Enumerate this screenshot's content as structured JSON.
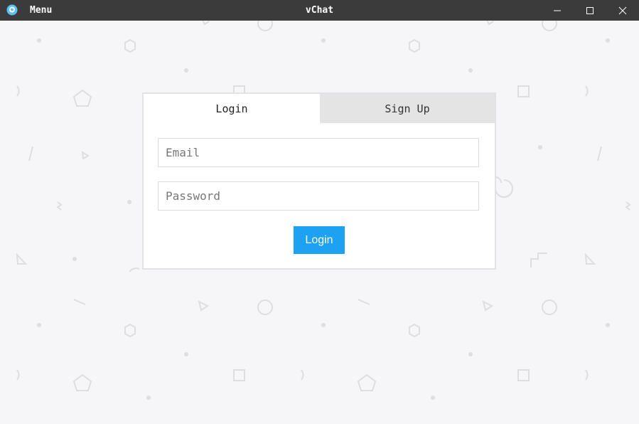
{
  "titlebar": {
    "app_icon": "vchat-logo-icon",
    "menu_label": "Menu",
    "window_title": "vChat",
    "controls": [
      "minimize-icon",
      "maximize-icon",
      "close-icon"
    ]
  },
  "auth": {
    "tabs": [
      {
        "label": "Login",
        "active": true
      },
      {
        "label": "Sign Up",
        "active": false
      }
    ],
    "email_placeholder": "Email",
    "email_value": "",
    "password_placeholder": "Password",
    "password_value": "",
    "submit_label": "Login"
  },
  "colors": {
    "titlebar_bg": "#3b3b3b",
    "background": "#f6f6f8",
    "accent": "#1da1f2",
    "inactive_tab": "#e4e4e4"
  }
}
